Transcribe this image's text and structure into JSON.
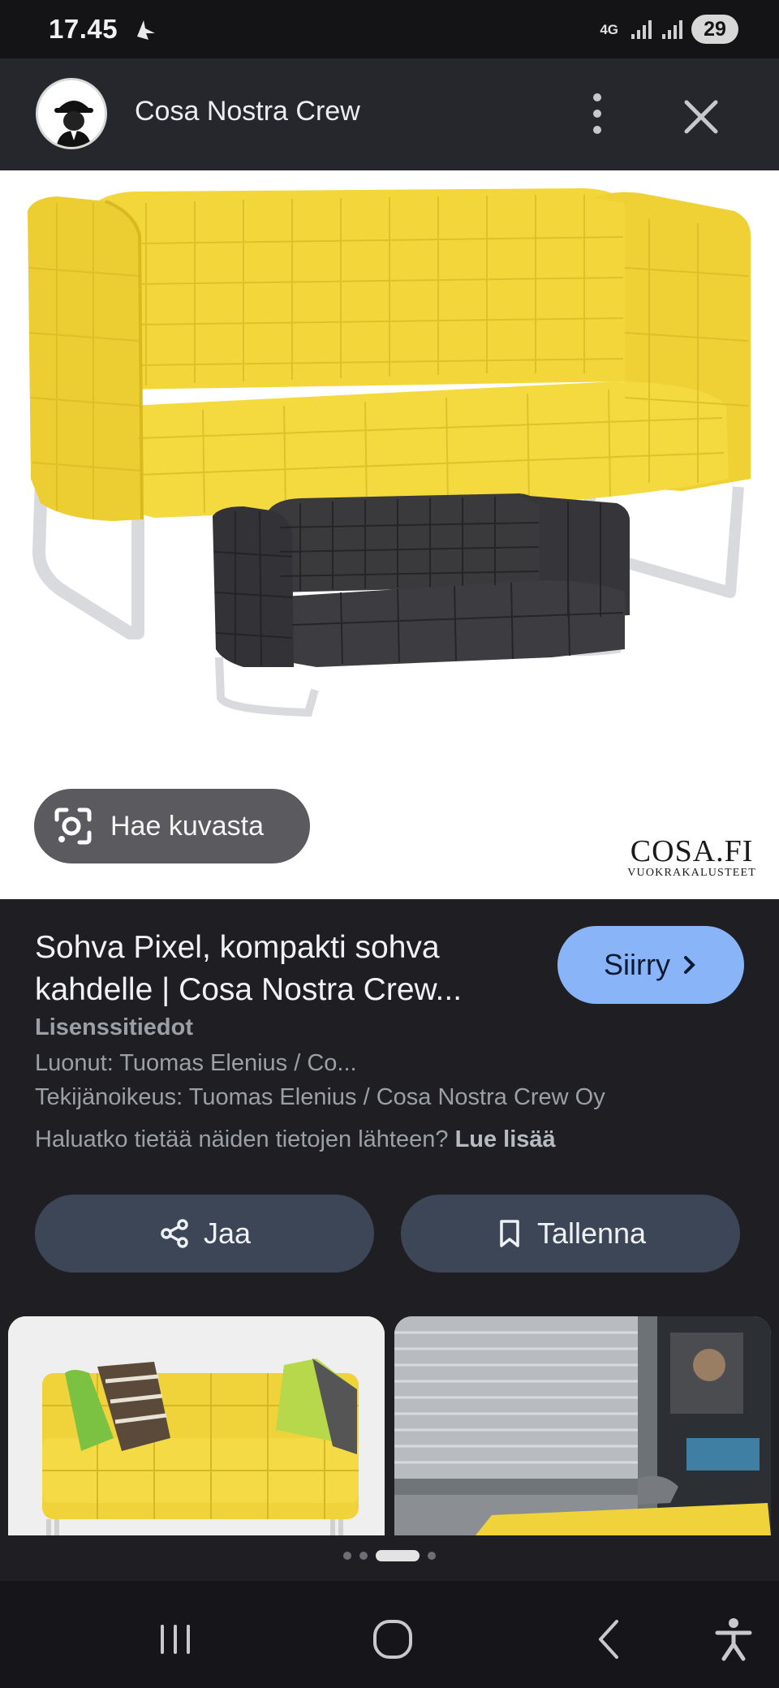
{
  "status_bar": {
    "time": "17.45",
    "network": "4G",
    "battery": "29"
  },
  "header": {
    "site_name": "Cosa Nostra Crew"
  },
  "image": {
    "lens_label": "Hae kuvasta",
    "watermark_main": "COSA.FI",
    "watermark_sub": "VUOKRAKALUSTEET"
  },
  "result": {
    "title": "Sohva Pixel, kompakti sohva kahdelle | Cosa Nostra Crew...",
    "goto_label": "Siirry",
    "license_title": "Lisenssitiedot",
    "creator": "Luonut: Tuomas Elenius / Co...",
    "copyright": "Tekijänoikeus: Tuomas Elenius / Cosa Nostra Crew Oy",
    "source_question": "Haluatko tietää näiden tietojen lähteen?",
    "more_link": "Lue lisää"
  },
  "actions": {
    "share_label": "Jaa",
    "save_label": "Tallenna"
  },
  "pagination": {
    "count": 4,
    "active_index": 2
  },
  "colors": {
    "accent": "#8ab4f8",
    "sofa_yellow": "#f2d63a",
    "sofa_dark": "#3b3b3e"
  }
}
